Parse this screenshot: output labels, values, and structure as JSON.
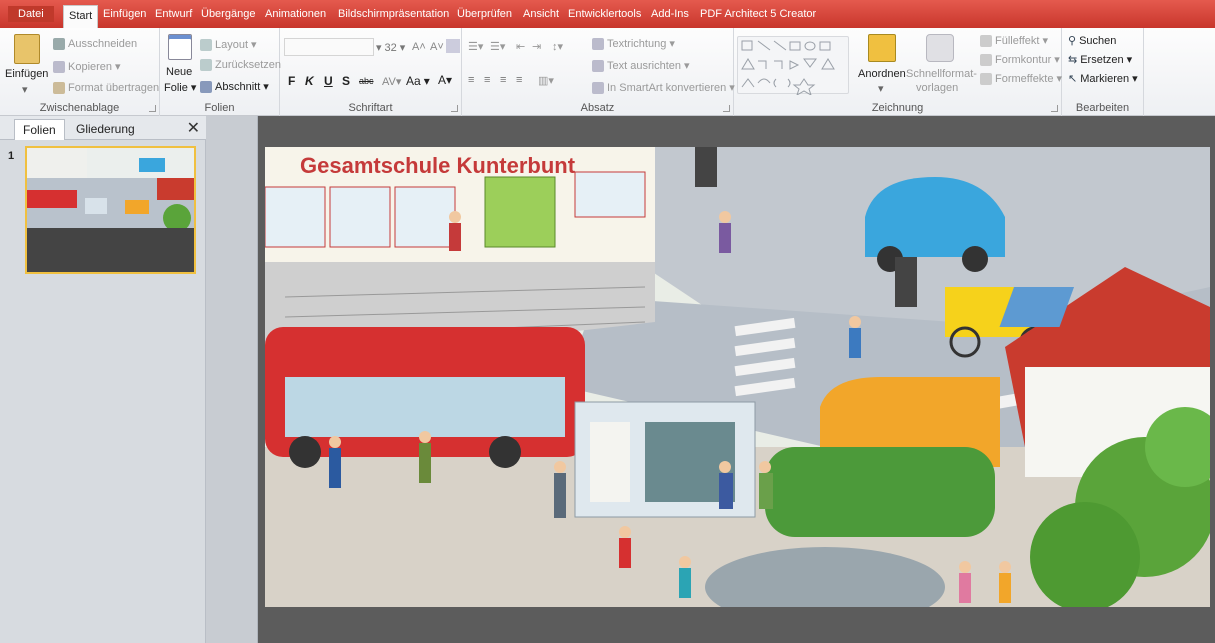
{
  "tabs": {
    "file": "Datei",
    "items": [
      "Start",
      "Einfügen",
      "Entwurf",
      "Übergänge",
      "Animationen",
      "Bildschirmpräsentation",
      "Überprüfen",
      "Ansicht",
      "Entwicklertools",
      "Add-Ins",
      "PDF Architect 5 Creator"
    ]
  },
  "clipboard": {
    "paste": "Einfügen",
    "cut": "Ausschneiden",
    "copy": "Kopieren",
    "format_painter": "Format übertragen",
    "label": "Zwischenablage"
  },
  "slides": {
    "new_slide_1": "Neue",
    "new_slide_2": "Folie",
    "layout": "Layout",
    "reset": "Zurücksetzen",
    "section": "Abschnitt",
    "label": "Folien"
  },
  "font": {
    "size": "32",
    "label": "Schriftart",
    "bold": "F",
    "italic": "K",
    "underline": "U",
    "shadow": "S",
    "strike": "abc",
    "case": "Aa"
  },
  "paragraph": {
    "text_direction": "Textrichtung",
    "align_text": "Text ausrichten",
    "smartart": "In SmartArt konvertieren",
    "label": "Absatz"
  },
  "drawing": {
    "arrange": "Anordnen",
    "quick_styles_1": "Schnellformat-",
    "quick_styles_2": "vorlagen",
    "fill": "Fülleffekt",
    "outline": "Formkontur",
    "effects": "Formeffekte",
    "label": "Zeichnung"
  },
  "editing": {
    "find": "Suchen",
    "replace": "Ersetzen",
    "select": "Markieren",
    "label": "Bearbeiten"
  },
  "left_pane": {
    "tab_slides": "Folien",
    "tab_outline": "Gliederung",
    "slide_number": "1"
  },
  "slide_content": {
    "school_sign": "Gesamtschule Kunterbunt"
  },
  "colors": {
    "title_bar": "#d2453a",
    "editor_bg": "#5c5c5c",
    "thumb_border": "#f0c040"
  }
}
